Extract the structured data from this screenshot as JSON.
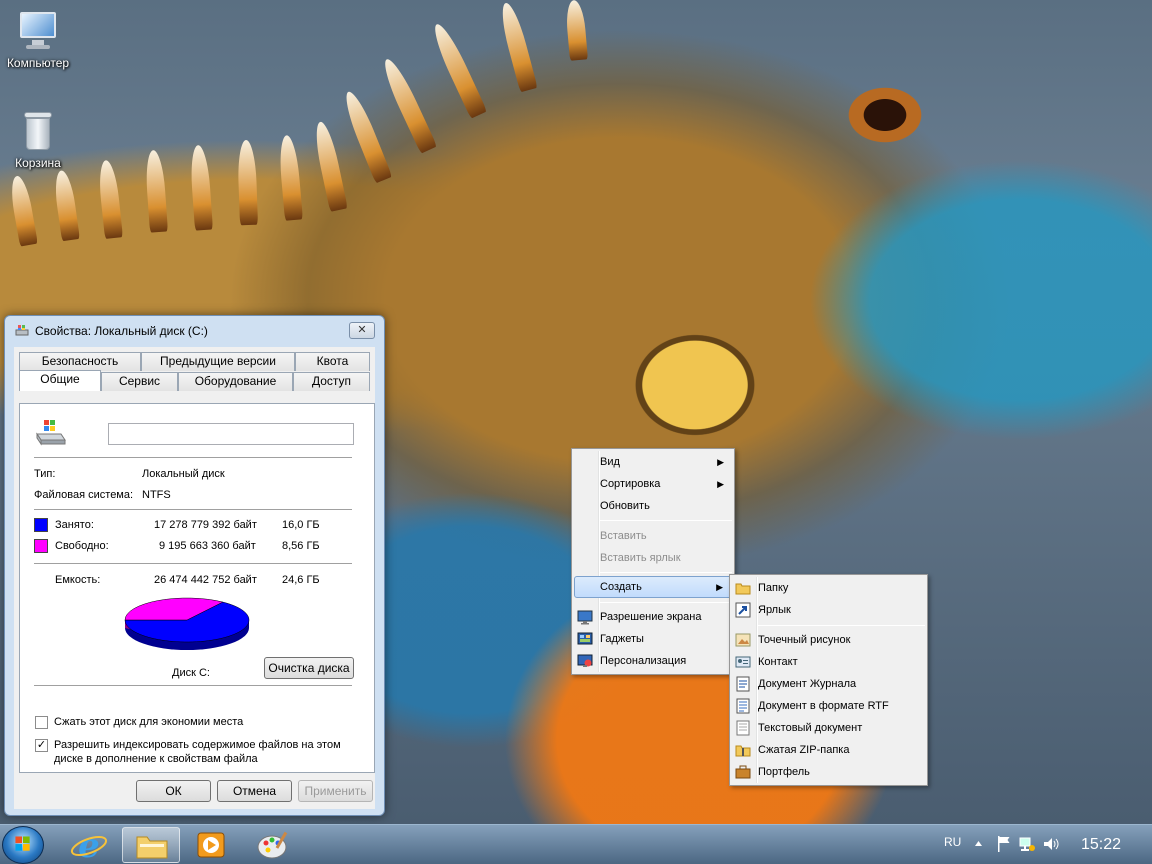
{
  "desktop": {
    "icons": [
      {
        "label": "Компьютер",
        "icon": "computer-icon"
      },
      {
        "label": "Корзина",
        "icon": "recycle-bin-icon"
      }
    ]
  },
  "dialog": {
    "title": "Свойства: Локальный диск (C:)",
    "close_glyph": "✕",
    "tabs_row1": [
      "Безопасность",
      "Предыдущие версии",
      "Квота"
    ],
    "tabs_row2": [
      "Общие",
      "Сервис",
      "Оборудование",
      "Доступ"
    ],
    "active_tab": "Общие",
    "name_value": "",
    "type_label": "Тип:",
    "type_value": "Локальный диск",
    "fs_label": "Файловая система:",
    "fs_value": "NTFS",
    "used_label": "Занято:",
    "used_bytes": "17 278 779 392 байт",
    "used_gb": "16,0 ГБ",
    "free_label": "Свободно:",
    "free_bytes": "9 195 663 360 байт",
    "free_gb": "8,56 ГБ",
    "capacity_label": "Емкость:",
    "capacity_bytes": "26 474 442 752 байт",
    "capacity_gb": "24,6 ГБ",
    "drive_label": "Диск C:",
    "cleanup_button": "Очистка диска",
    "compress_checkbox": "Сжать этот диск для экономии места",
    "compress_checked": false,
    "index_checkbox_line1": "Разрешить индексировать содержимое файлов на этом",
    "index_checkbox_line2": "диске в дополнение к свойствам файла",
    "index_checked": true,
    "check_mark": "✓",
    "ok_button": "ОК",
    "cancel_button": "Отмена",
    "apply_button": "Применить",
    "colors": {
      "used": "#0000ff",
      "free": "#ff00ff"
    },
    "pie": {
      "used_fraction": 0.652,
      "free_fraction": 0.348
    }
  },
  "context_menu": {
    "items": [
      {
        "label": "Вид",
        "submenu": true,
        "disabled": false
      },
      {
        "label": "Сортировка",
        "submenu": true,
        "disabled": false
      },
      {
        "label": "Обновить",
        "submenu": false,
        "disabled": false
      },
      {
        "label": "Вставить",
        "submenu": false,
        "disabled": true
      },
      {
        "label": "Вставить ярлык",
        "submenu": false,
        "disabled": true
      },
      {
        "label": "Создать",
        "submenu": true,
        "disabled": false,
        "highlighted": true
      },
      {
        "label": "Разрешение экрана",
        "icon": "display-icon"
      },
      {
        "label": "Гаджеты",
        "icon": "gadgets-icon"
      },
      {
        "label": "Персонализация",
        "icon": "personalize-icon"
      }
    ],
    "arrow_glyph": "▶"
  },
  "new_submenu": {
    "items": [
      {
        "label": "Папку",
        "icon": "folder-icon"
      },
      {
        "label": "Ярлык",
        "icon": "shortcut-icon"
      },
      {
        "label": "Точечный рисунок",
        "icon": "bitmap-icon"
      },
      {
        "label": "Контакт",
        "icon": "contact-icon"
      },
      {
        "label": "Документ Журнала",
        "icon": "journal-icon"
      },
      {
        "label": "Документ в формате RTF",
        "icon": "rtf-icon"
      },
      {
        "label": "Текстовый документ",
        "icon": "text-doc-icon"
      },
      {
        "label": "Сжатая ZIP-папка",
        "icon": "zip-folder-icon"
      },
      {
        "label": "Портфель",
        "icon": "briefcase-icon"
      }
    ]
  },
  "taskbar": {
    "apps": [
      {
        "name": "internet-explorer",
        "icon": "ie-icon",
        "active": false
      },
      {
        "name": "explorer",
        "icon": "folder-icon",
        "active": true
      },
      {
        "name": "media-player",
        "icon": "media-player-icon",
        "active": false
      },
      {
        "name": "paint",
        "icon": "paint-icon",
        "active": false
      }
    ],
    "language": "RU",
    "time": "15:22"
  }
}
